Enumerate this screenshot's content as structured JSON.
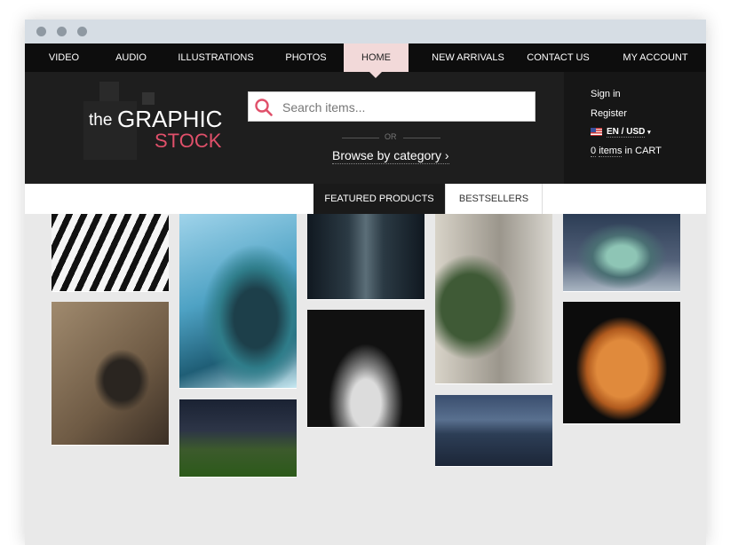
{
  "nav": {
    "items": [
      {
        "label": "VIDEO"
      },
      {
        "label": "AUDIO"
      },
      {
        "label": "ILLUSTRATIONS"
      },
      {
        "label": "PHOTOS"
      },
      {
        "label": "HOME",
        "active": true
      },
      {
        "label": "NEW ARRIVALS"
      },
      {
        "label": "CONTACT US"
      },
      {
        "label": "MY ACCOUNT"
      }
    ]
  },
  "logo": {
    "the": "the",
    "graphic": "GRAPHIC",
    "stock": "STOCK"
  },
  "search": {
    "placeholder": "Search items...",
    "icon": "search-icon"
  },
  "or_label": "OR",
  "browse_label": "Browse by category",
  "browse_chevron": "›",
  "account": {
    "sign_in": "Sign in",
    "register": "Register",
    "locale": "EN / USD",
    "locale_caret": "▾",
    "cart_count": "0",
    "cart_items": "items",
    "cart_suffix": "in CART"
  },
  "tabs": {
    "featured": "FEATURED PRODUCTS",
    "bestsellers": "BESTSELLERS"
  },
  "colors": {
    "accent": "#e0506a",
    "nav_bg": "#0d0d0d",
    "nav_active": "#f2d9d9",
    "header_bg": "#1e1e1e"
  }
}
